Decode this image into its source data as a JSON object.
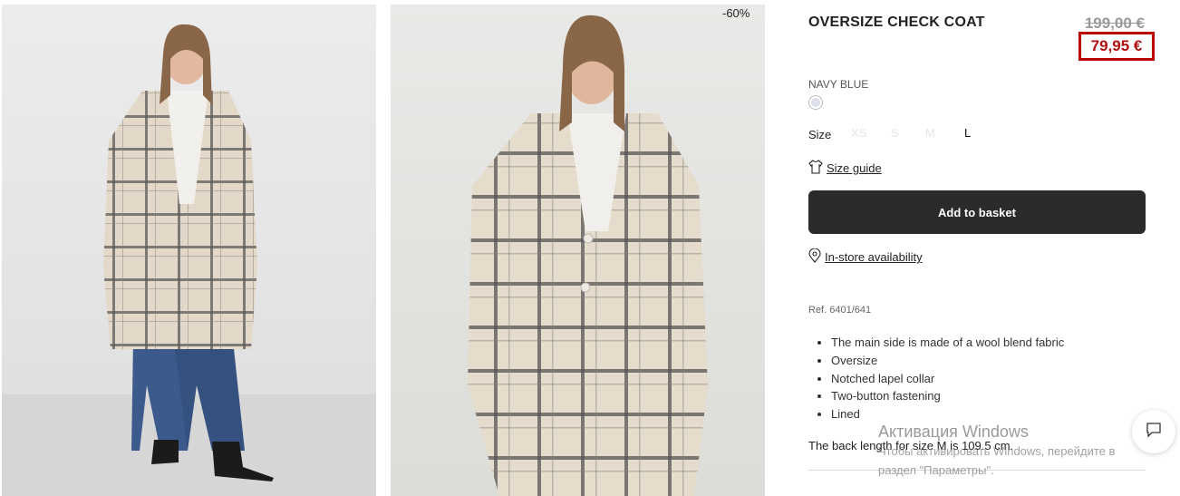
{
  "product": {
    "title": "OVERSIZE CHECK COAT",
    "old_price": "199,00 €",
    "new_price": "79,95 €",
    "discount": "-60%",
    "color_name": "NAVY BLUE",
    "size_label": "Size",
    "sizes": [
      "XS",
      "S",
      "M",
      "L"
    ],
    "selected_size": "L",
    "size_guide": "Size guide",
    "add_to_basket": "Add to basket",
    "store_availability": "In-store availability",
    "ref": "Ref. 6401/641",
    "features": [
      "The main side is made of a wool blend fabric",
      "Oversize",
      "Notched lapel collar",
      "Two-button fastening",
      "Lined"
    ],
    "back_length": "The back length for size M is 109.5 cm."
  },
  "watermark": {
    "title": "Активация Windows",
    "line1": "Чтобы активировать Windows, перейдите в",
    "line2": "раздел \"Параметры\"."
  },
  "icons": {
    "size_guide": "shirt-icon",
    "store": "location-pin-icon",
    "chat": "chat-bubble-icon"
  },
  "colors": {
    "price_highlight": "#b01010",
    "button_bg": "#2b2b2b",
    "swatch": "#dde0ea"
  }
}
